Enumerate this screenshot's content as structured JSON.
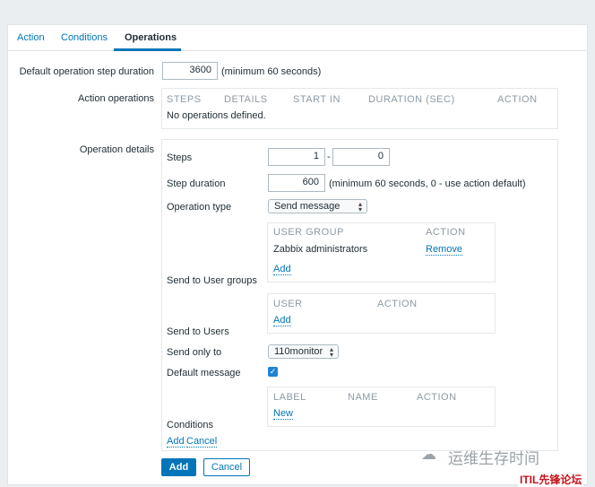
{
  "tabs": [
    {
      "label": "Action"
    },
    {
      "label": "Conditions"
    },
    {
      "label": "Operations"
    }
  ],
  "step_duration": {
    "label": "Default operation step duration",
    "value": "3600",
    "hint": "(minimum 60 seconds)"
  },
  "action_operations": {
    "label": "Action operations",
    "columns": [
      "STEPS",
      "DETAILS",
      "START IN",
      "DURATION (SEC)",
      "ACTION"
    ],
    "empty": "No operations defined."
  },
  "operation_details": {
    "label": "Operation details",
    "steps_label": "Steps",
    "steps_from": "1",
    "steps_sep": "-",
    "steps_to": "0",
    "duration_label": "Step duration",
    "duration_value": "600",
    "duration_hint": "(minimum 60 seconds, 0 - use action default)",
    "type_label": "Operation type",
    "type_value": "Send message",
    "user_groups": {
      "label": "Send to User groups",
      "col_group": "USER GROUP",
      "col_action": "ACTION",
      "rows": [
        {
          "name": "Zabbix administrators",
          "action": "Remove"
        }
      ],
      "add": "Add"
    },
    "users": {
      "label": "Send to Users",
      "col_user": "USER",
      "col_action": "ACTION",
      "add": "Add"
    },
    "send_only_label": "Send only to",
    "send_only_value": "110monitor",
    "default_message_label": "Default message",
    "default_message_checked": true,
    "conditions": {
      "label": "Conditions",
      "col_label": "LABEL",
      "col_name": "NAME",
      "col_action": "ACTION",
      "new": "New"
    },
    "add": "Add",
    "cancel": "Cancel"
  },
  "buttons": {
    "add": "Add",
    "cancel": "Cancel"
  },
  "watermark": "运维生存时间",
  "badge": "ITIL先锋论坛",
  "colors": {
    "accent": "#0275b8",
    "checkbox": "#1d84d3",
    "badge": "#c8141e"
  }
}
